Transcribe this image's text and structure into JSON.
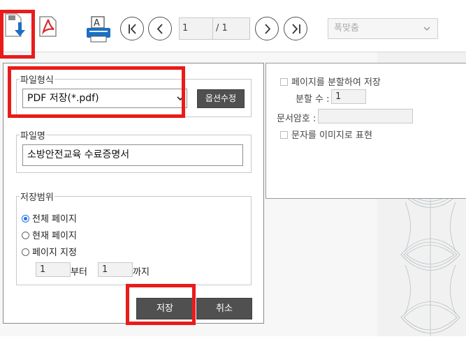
{
  "toolbar": {
    "page_current": "1",
    "page_total": "/ 1",
    "zoom_selected": "폭맞춤",
    "icons": [
      "save-download-icon",
      "pdf-icon",
      "print-icon",
      "first-page-icon",
      "prev-page-icon",
      "next-page-icon",
      "last-page-icon"
    ]
  },
  "dialog": {
    "file_format": {
      "legend": "파일형식",
      "selected": "PDF 저장(*.pdf)",
      "options_button": "옵션수정"
    },
    "file_name": {
      "legend": "파일명",
      "value": "소방안전교육 수료증명서"
    },
    "save_range": {
      "legend": "저장범위",
      "options": [
        "전체 페이지",
        "현재 페이지",
        "페이지 지정"
      ],
      "selected_index": 0,
      "from_value": "1",
      "from_label": "부터",
      "to_value": "1",
      "to_label": "까지"
    },
    "save_button": "저장",
    "cancel_button": "취소"
  },
  "options_panel": {
    "split_pages_label": "페이지를 분할하여 저장",
    "split_count_label": "분할 수 :",
    "split_count_value": "1",
    "doc_password_label": "문서암호 :",
    "doc_password_value": "",
    "text_as_image_label": "문자를 이미지로 표현"
  },
  "colors": {
    "highlight": "#ea1b1b",
    "button_dark": "#505050",
    "pdf_red": "#d82d2d",
    "icon_blue": "#1c6fc4"
  }
}
